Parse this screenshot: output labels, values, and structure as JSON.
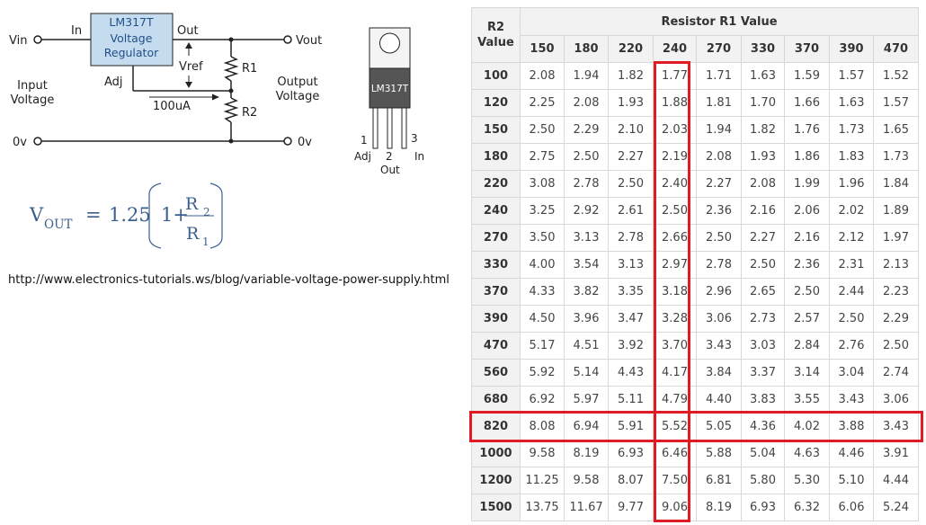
{
  "circuit": {
    "labels": {
      "vin": "Vin",
      "in": "In",
      "out": "Out",
      "vout": "Vout",
      "regulator_line1": "LM317T",
      "regulator_line2": "Voltage",
      "regulator_line3": "Regulator",
      "vref": "Vref",
      "adj": "Adj",
      "r1": "R1",
      "r2": "R2",
      "current": "100uA",
      "input_voltage_1": "Input",
      "input_voltage_2": "Voltage",
      "output_voltage_1": "Output",
      "output_voltage_2": "Voltage",
      "ground_left": "0v",
      "ground_right": "0v"
    },
    "colors": {
      "regulator_fill": "#c5dcef",
      "wire": "#222222"
    }
  },
  "package": {
    "chip_label": "LM317T",
    "pin_numbers": [
      "1",
      "2",
      "3"
    ],
    "pin_names": [
      "Adj",
      "Out",
      "In"
    ]
  },
  "formula": {
    "v": "V",
    "out_sub": "OUT",
    "equals": "=",
    "coefficient": "1.25",
    "one_plus": "1+",
    "r_num": "R",
    "r_num_sub": "2",
    "r_den": "R",
    "r_den_sub": "1",
    "color": "#3a5f8f"
  },
  "url": "http://www.electronics-tutorials.ws/blog/variable-voltage-power-supply.html",
  "table": {
    "corner_line1": "R2",
    "corner_line2": "Value",
    "title": "Resistor R1 Value",
    "columns": [
      "150",
      "180",
      "220",
      "240",
      "270",
      "330",
      "370",
      "390",
      "470"
    ],
    "rows": [
      {
        "r2": "100",
        "values": [
          "2.08",
          "1.94",
          "1.82",
          "1.77",
          "1.71",
          "1.63",
          "1.59",
          "1.57",
          "1.52"
        ]
      },
      {
        "r2": "120",
        "values": [
          "2.25",
          "2.08",
          "1.93",
          "1.88",
          "1.81",
          "1.70",
          "1.66",
          "1.63",
          "1.57"
        ]
      },
      {
        "r2": "150",
        "values": [
          "2.50",
          "2.29",
          "2.10",
          "2.03",
          "1.94",
          "1.82",
          "1.76",
          "1.73",
          "1.65"
        ]
      },
      {
        "r2": "180",
        "values": [
          "2.75",
          "2.50",
          "2.27",
          "2.19",
          "2.08",
          "1.93",
          "1.86",
          "1.83",
          "1.73"
        ]
      },
      {
        "r2": "220",
        "values": [
          "3.08",
          "2.78",
          "2.50",
          "2.40",
          "2.27",
          "2.08",
          "1.99",
          "1.96",
          "1.84"
        ]
      },
      {
        "r2": "240",
        "values": [
          "3.25",
          "2.92",
          "2.61",
          "2.50",
          "2.36",
          "2.16",
          "2.06",
          "2.02",
          "1.89"
        ]
      },
      {
        "r2": "270",
        "values": [
          "3.50",
          "3.13",
          "2.78",
          "2.66",
          "2.50",
          "2.27",
          "2.16",
          "2.12",
          "1.97"
        ]
      },
      {
        "r2": "330",
        "values": [
          "4.00",
          "3.54",
          "3.13",
          "2.97",
          "2.78",
          "2.50",
          "2.36",
          "2.31",
          "2.13"
        ]
      },
      {
        "r2": "370",
        "values": [
          "4.33",
          "3.82",
          "3.35",
          "3.18",
          "2.96",
          "2.65",
          "2.50",
          "2.44",
          "2.23"
        ]
      },
      {
        "r2": "390",
        "values": [
          "4.50",
          "3.96",
          "3.47",
          "3.28",
          "3.06",
          "2.73",
          "2.57",
          "2.50",
          "2.29"
        ]
      },
      {
        "r2": "470",
        "values": [
          "5.17",
          "4.51",
          "3.92",
          "3.70",
          "3.43",
          "3.03",
          "2.84",
          "2.76",
          "2.50"
        ]
      },
      {
        "r2": "560",
        "values": [
          "5.92",
          "5.14",
          "4.43",
          "4.17",
          "3.84",
          "3.37",
          "3.14",
          "3.04",
          "2.74"
        ]
      },
      {
        "r2": "680",
        "values": [
          "6.92",
          "5.97",
          "5.11",
          "4.79",
          "4.40",
          "3.83",
          "3.55",
          "3.43",
          "3.06"
        ]
      },
      {
        "r2": "820",
        "values": [
          "8.08",
          "6.94",
          "5.91",
          "5.52",
          "5.05",
          "4.36",
          "4.02",
          "3.88",
          "3.43"
        ]
      },
      {
        "r2": "1000",
        "values": [
          "9.58",
          "8.19",
          "6.93",
          "6.46",
          "5.88",
          "5.04",
          "4.63",
          "4.46",
          "3.91"
        ]
      },
      {
        "r2": "1200",
        "values": [
          "11.25",
          "9.58",
          "8.07",
          "7.50",
          "6.81",
          "5.80",
          "5.30",
          "5.10",
          "4.44"
        ]
      },
      {
        "r2": "1500",
        "values": [
          "13.75",
          "11.67",
          "9.77",
          "9.06",
          "8.19",
          "6.93",
          "6.32",
          "6.06",
          "5.24"
        ]
      }
    ],
    "highlight_color": "#e01b24"
  }
}
